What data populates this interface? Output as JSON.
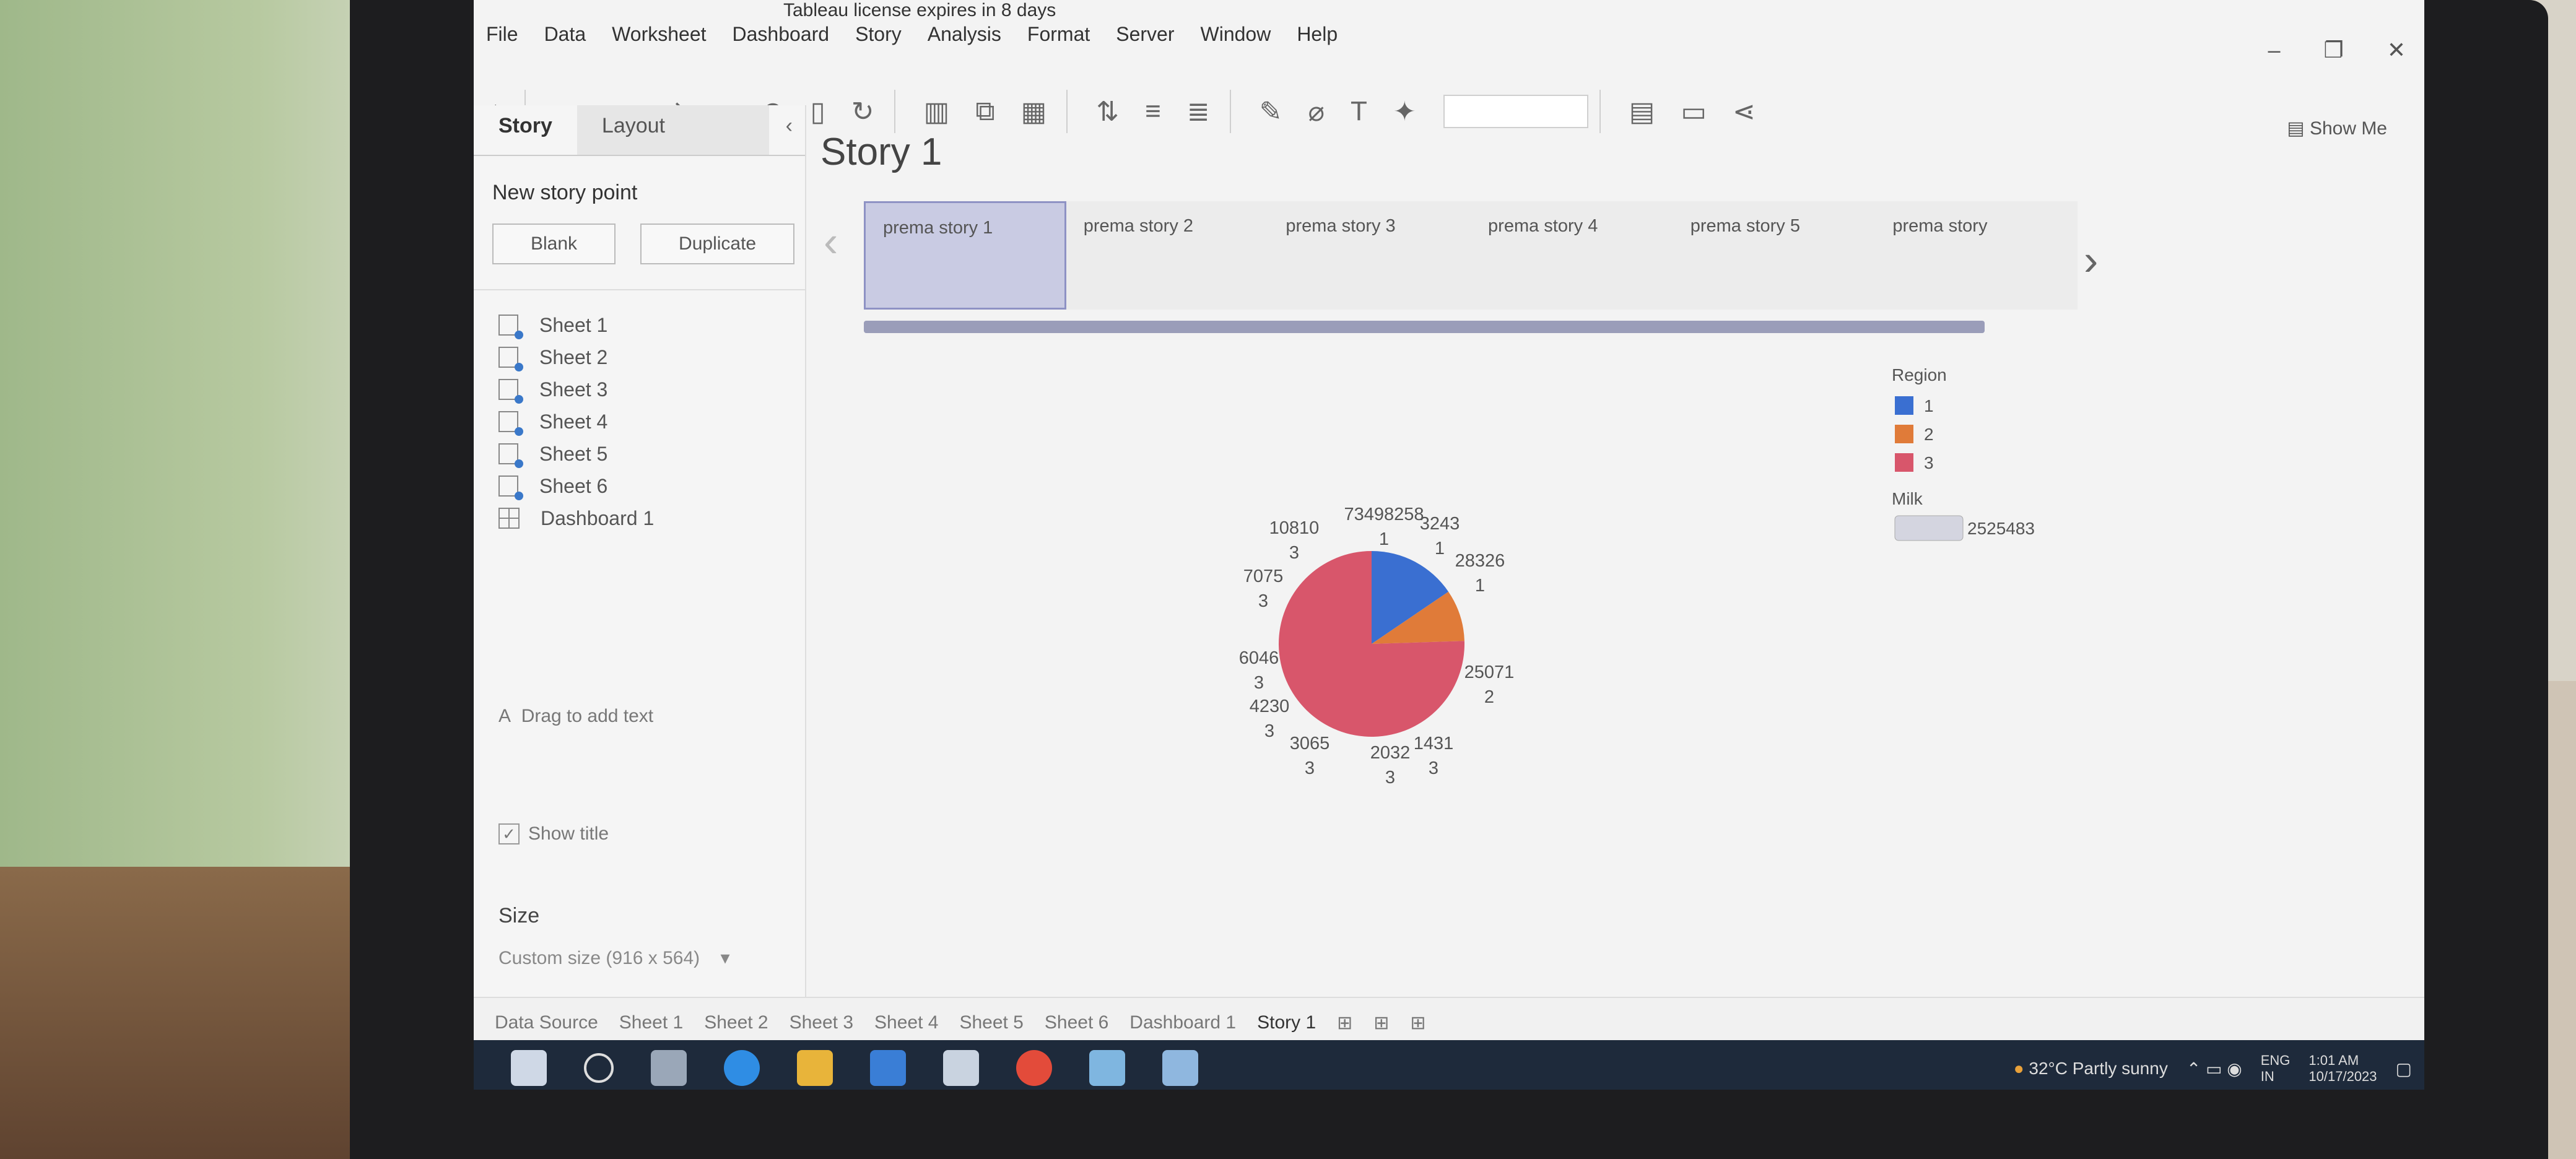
{
  "window": {
    "title_banner": "Tableau license expires in 8 days"
  },
  "menu": [
    "File",
    "Data",
    "Worksheet",
    "Dashboard",
    "Story",
    "Analysis",
    "Format",
    "Server",
    "Window",
    "Help"
  ],
  "toolbar": {
    "show_me": "Show Me"
  },
  "sidepanel": {
    "tabs": [
      "Story",
      "Layout"
    ],
    "new_story_point": "New story point",
    "blank": "Blank",
    "duplicate": "Duplicate",
    "sheets": [
      "Sheet 1",
      "Sheet 2",
      "Sheet 3",
      "Sheet 4",
      "Sheet 5",
      "Sheet 6",
      "Dashboard 1"
    ],
    "drag_to_add_text": "Drag to add text",
    "show_title": "Show title",
    "size_label": "Size",
    "size_value": "Custom size (916 x 564)"
  },
  "story": {
    "title": "Story 1",
    "points": [
      "prema story 1",
      "prema story 2",
      "prema story 3",
      "prema story 4",
      "prema story 5",
      "prema story"
    ],
    "active_point": 0
  },
  "chart_data": {
    "type": "pie",
    "legend_title": "Region",
    "legend": [
      {
        "label": "1",
        "color": "#3a6fd1"
      },
      {
        "label": "2",
        "color": "#e07b39"
      },
      {
        "label": "3",
        "color": "#d8566b"
      }
    ],
    "size_legend": {
      "title": "Milk",
      "value": "2525483"
    },
    "slices": [
      {
        "value": 73498258,
        "region": "1",
        "label": "73498258",
        "sub": "1"
      },
      {
        "value": 3243,
        "region": "1",
        "label": "3243",
        "sub": "1"
      },
      {
        "value": 28326,
        "region": "1",
        "label": "28326",
        "sub": "1"
      },
      {
        "value": 25071,
        "region": "2",
        "label": "25071",
        "sub": "2"
      },
      {
        "value": 1431,
        "region": "3",
        "label": "1431",
        "sub": "3"
      },
      {
        "value": 2032,
        "region": "3",
        "label": "2032",
        "sub": "3"
      },
      {
        "value": 3065,
        "region": "3",
        "label": "3065",
        "sub": "3"
      },
      {
        "value": 4230,
        "region": "3",
        "label": "4230",
        "sub": "3"
      },
      {
        "value": 6046,
        "region": "3",
        "label": "6046",
        "sub": "3"
      },
      {
        "value": 7075,
        "region": "3",
        "label": "7075",
        "sub": "3"
      },
      {
        "value": 10810,
        "region": "3",
        "label": "10810",
        "sub": "3"
      }
    ]
  },
  "tabs": [
    "Data Source",
    "Sheet 1",
    "Sheet 2",
    "Sheet 3",
    "Sheet 4",
    "Sheet 5",
    "Sheet 6",
    "Dashboard 1",
    "Story 1"
  ],
  "tray": {
    "weather": "32°C  Partly sunny",
    "lang1": "ENG",
    "lang2": "IN",
    "time": "1:01 AM",
    "date": "10/17/2023"
  }
}
